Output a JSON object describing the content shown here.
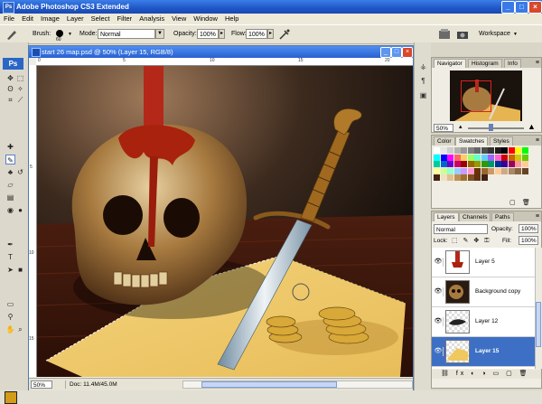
{
  "app": {
    "title": "Adobe Photoshop CS3 Extended",
    "logo": "Ps",
    "window_controls": [
      "_",
      "□",
      "×"
    ]
  },
  "menu": [
    "File",
    "Edit",
    "Image",
    "Layer",
    "Select",
    "Filter",
    "Analysis",
    "View",
    "Window",
    "Help"
  ],
  "options_bar": {
    "brush_label": "Brush:",
    "brush_size": "60",
    "mode_label": "Mode:",
    "mode_value": "Normal",
    "opacity_label": "Opacity:",
    "opacity_value": "100%",
    "flow_label": "Flow:",
    "flow_value": "100%",
    "workspace_label": "Workspace"
  },
  "document": {
    "title": "start 26 map.psd @ 50% (Layer 15, RGB/8)",
    "zoom": "50%",
    "doc_info": "Doc: 11.4M/45.0M",
    "ruler_top": [
      "0",
      "5",
      "10",
      "15",
      "20"
    ],
    "ruler_left": [
      "5",
      "10",
      "15"
    ]
  },
  "navigator": {
    "tabs": [
      "Navigator",
      "Histogram",
      "Info"
    ],
    "active_tab": "Navigator",
    "zoom": "50%"
  },
  "swatches": {
    "tabs": [
      "Color",
      "Swatches",
      "Styles"
    ],
    "active_tab": "Swatches",
    "colors": [
      "#ffffff",
      "#e6e6e6",
      "#cccccc",
      "#b3b3b3",
      "#999999",
      "#808080",
      "#666666",
      "#4d4d4d",
      "#333333",
      "#1a1a1a",
      "#000000",
      "#ff0000",
      "#ffff00",
      "#00ff00",
      "#00ffff",
      "#0000ff",
      "#ff00ff",
      "#ff6666",
      "#ffcc66",
      "#99ff66",
      "#66ffcc",
      "#66ccff",
      "#9966ff",
      "#ff66cc",
      "#cc0000",
      "#cc6600",
      "#cccc00",
      "#66cc00",
      "#00cc99",
      "#0066cc",
      "#6600cc",
      "#cc0066",
      "#990000",
      "#996600",
      "#999900",
      "#339900",
      "#009966",
      "#003399",
      "#330099",
      "#990066",
      "#ff9999",
      "#ffcc99",
      "#ffff99",
      "#ccff99",
      "#99ffcc",
      "#99ccff",
      "#cc99ff",
      "#ff99cc",
      "#663300",
      "#996633",
      "#cc9966",
      "#ffcc99",
      "#ccaa88",
      "#aa8866",
      "#886644",
      "#664422",
      "#442211",
      "#f0e0c0",
      "#e0c090",
      "#c09050",
      "#a07030",
      "#805020",
      "#603010",
      "#402010"
    ]
  },
  "layers": {
    "tabs": [
      "Layers",
      "Channels",
      "Paths"
    ],
    "active_tab": "Layers",
    "blend_mode": "Normal",
    "opacity_label": "Opacity:",
    "opacity_value": "100%",
    "lock_label": "Lock:",
    "fill_label": "Fill:",
    "fill_value": "100%",
    "items": [
      {
        "name": "Layer 5",
        "visible": true,
        "selected": false
      },
      {
        "name": "Background copy",
        "visible": true,
        "selected": false
      },
      {
        "name": "Layer 12",
        "visible": true,
        "selected": false
      },
      {
        "name": "Layer 15",
        "visible": true,
        "selected": true
      }
    ]
  },
  "colors": {
    "foreground": "#d39c18",
    "selection_highlight": "#3d6fc5"
  },
  "icons": {
    "toolbox": [
      "move-icon",
      "marquee-icon",
      "lasso-icon",
      "magic-wand-icon",
      "crop-icon",
      "slice-icon",
      "healing-icon",
      "brush-icon",
      "clone-stamp-icon",
      "history-brush-icon",
      "eraser-icon",
      "gradient-icon",
      "blur-icon",
      "dodge-icon",
      "pen-icon",
      "type-icon",
      "path-select-icon",
      "shape-icon",
      "notes-icon",
      "eyedropper-icon",
      "hand-icon",
      "zoom-icon"
    ],
    "dock": [
      "navigator-dock-icon",
      "info-dock-icon",
      "layers-dock-icon"
    ]
  }
}
